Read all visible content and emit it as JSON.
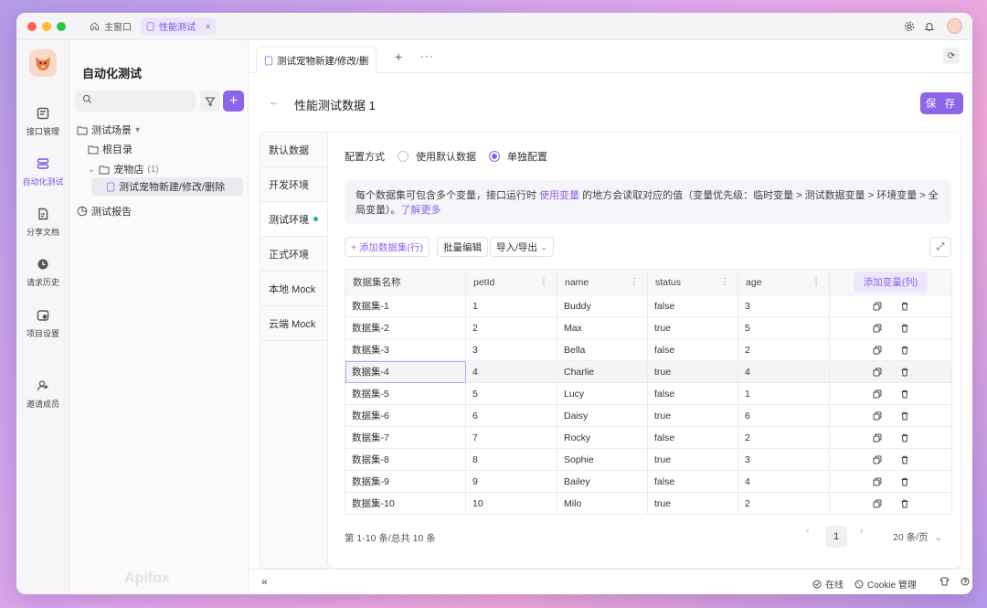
{
  "titlebar": {
    "home_tab": "主窗口",
    "active_tab": "性能测试",
    "close_glyph": "×"
  },
  "rail": [
    {
      "label": "接口管理",
      "icon": "api-icon"
    },
    {
      "label": "自动化测试",
      "icon": "automation-icon",
      "active": true
    },
    {
      "label": "分享文档",
      "icon": "share-doc-icon"
    },
    {
      "label": "请求历史",
      "icon": "history-icon"
    },
    {
      "label": "项目设置",
      "icon": "settings-icon"
    },
    {
      "label": "邀请成员",
      "icon": "invite-icon"
    }
  ],
  "tree": {
    "title": "自动化测试",
    "scenes_label": "测试场景",
    "root": "根目录",
    "folder": "宠物店",
    "folder_count": "(1)",
    "case": "测试宠物新建/修改/删除",
    "report": "测试报告",
    "watermark": "Apifox"
  },
  "doc": {
    "tab_label": "测试宠物新建/修改/删",
    "page_title": "性能测试数据 1",
    "save_label": "保 存"
  },
  "envs": [
    "默认数据",
    "开发环境",
    "测试环境",
    "正式环境",
    "本地 Mock",
    "云端 Mock"
  ],
  "config": {
    "label": "配置方式",
    "opt_default": "使用默认数据",
    "opt_single": "单独配置"
  },
  "info": {
    "part1": "每个数据集可包含多个变量，接口运行时 ",
    "link1": "使用变量",
    "part2": " 的地方会读取对应的值（变量优先级：临时变量 > 测试数据变量 > 环境变量 > 全局变量）。",
    "link2": "了解更多"
  },
  "toolbar": {
    "add_row": "+ 添加数据集(行)",
    "batch_edit": "批量编辑",
    "import_export": "导入/导出"
  },
  "table": {
    "headers": [
      "数据集名称",
      "petId",
      "name",
      "status",
      "age"
    ],
    "add_col": "添加变量(列)",
    "rows": [
      [
        "数据集-1",
        "1",
        "Buddy",
        "false",
        "3"
      ],
      [
        "数据集-2",
        "2",
        "Max",
        "true",
        "5"
      ],
      [
        "数据集-3",
        "3",
        "Bella",
        "false",
        "2"
      ],
      [
        "数据集-4",
        "4",
        "Charlie",
        "true",
        "4"
      ],
      [
        "数据集-5",
        "5",
        "Lucy",
        "false",
        "1"
      ],
      [
        "数据集-6",
        "6",
        "Daisy",
        "true",
        "6"
      ],
      [
        "数据集-7",
        "7",
        "Rocky",
        "false",
        "2"
      ],
      [
        "数据集-8",
        "8",
        "Sophie",
        "true",
        "3"
      ],
      [
        "数据集-9",
        "9",
        "Bailey",
        "false",
        "4"
      ],
      [
        "数据集-10",
        "10",
        "Milo",
        "true",
        "2"
      ]
    ]
  },
  "pagination": {
    "summary": "第 1-10 条/总共 10 条",
    "page": "1",
    "prev": "‹",
    "next": "›",
    "page_size": "20 条/页"
  },
  "statusbar": {
    "online": "在线",
    "cookie": "Cookie 管理"
  },
  "colors": {
    "accent": "#8d64ea",
    "online_dot": "#1db77a"
  }
}
